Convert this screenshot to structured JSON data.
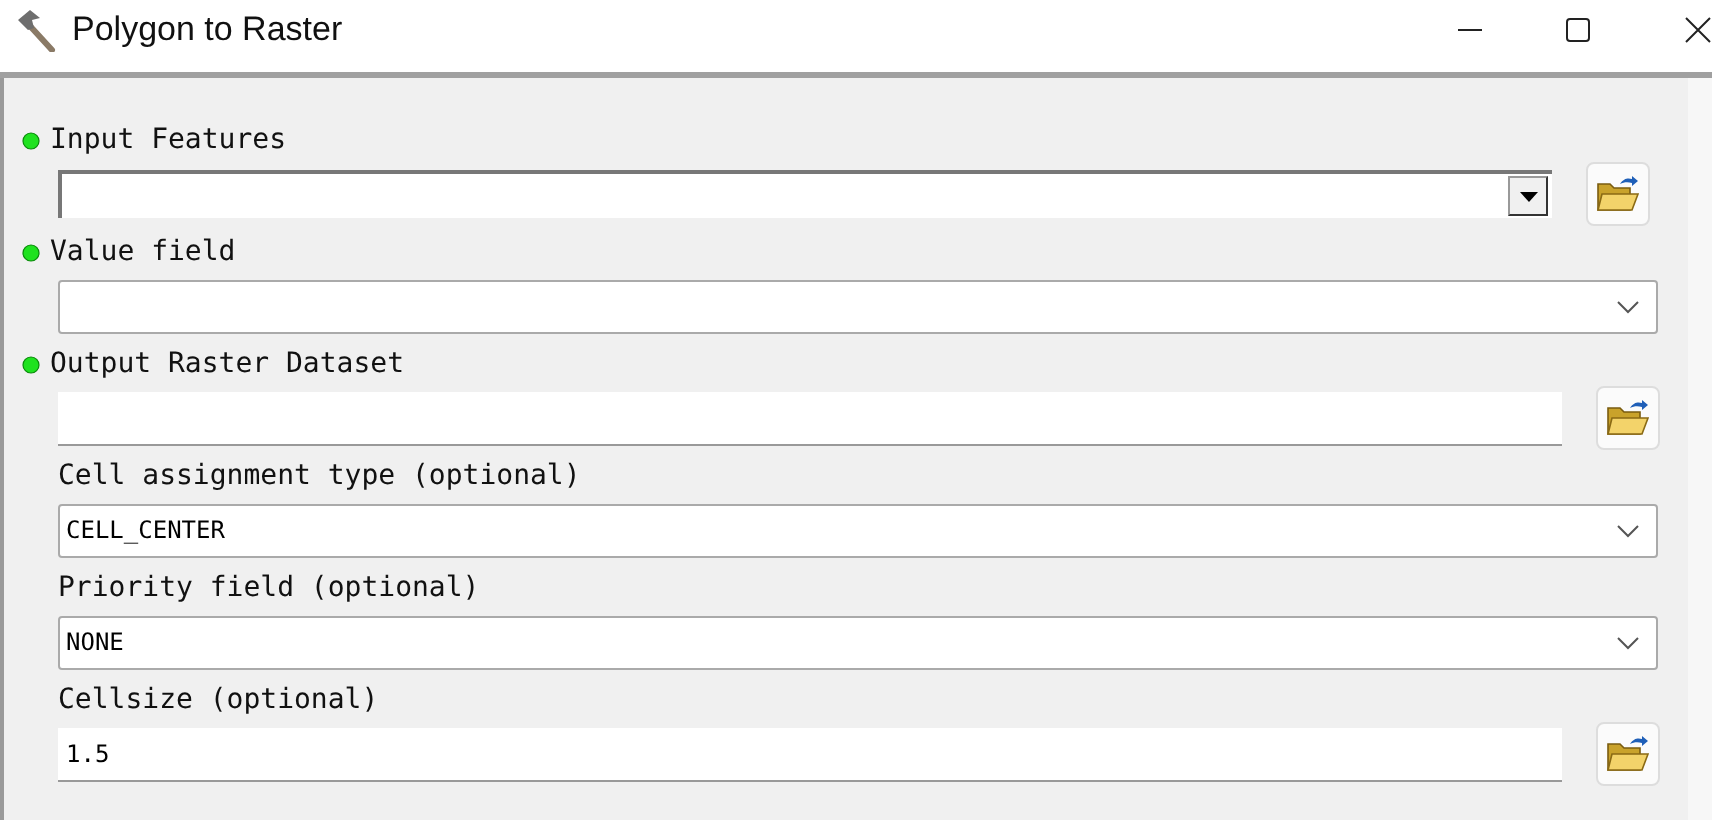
{
  "window": {
    "title": "Polygon to Raster"
  },
  "parameters": [
    {
      "label": "Input Features",
      "required": true,
      "kind": "classic-combo"
    },
    {
      "label": "Value field",
      "required": true,
      "kind": "combo"
    },
    {
      "label": "Output Raster Dataset",
      "required": true,
      "kind": "browse"
    },
    {
      "label": "Cell assignment type (optional)",
      "required": false,
      "kind": "combo",
      "value": "CELL_CENTER"
    },
    {
      "label": "Priority field (optional)",
      "required": false,
      "kind": "combo",
      "value": "NONE"
    },
    {
      "label": "Cellsize (optional)",
      "required": false,
      "kind": "browse",
      "value": "1.5"
    }
  ]
}
